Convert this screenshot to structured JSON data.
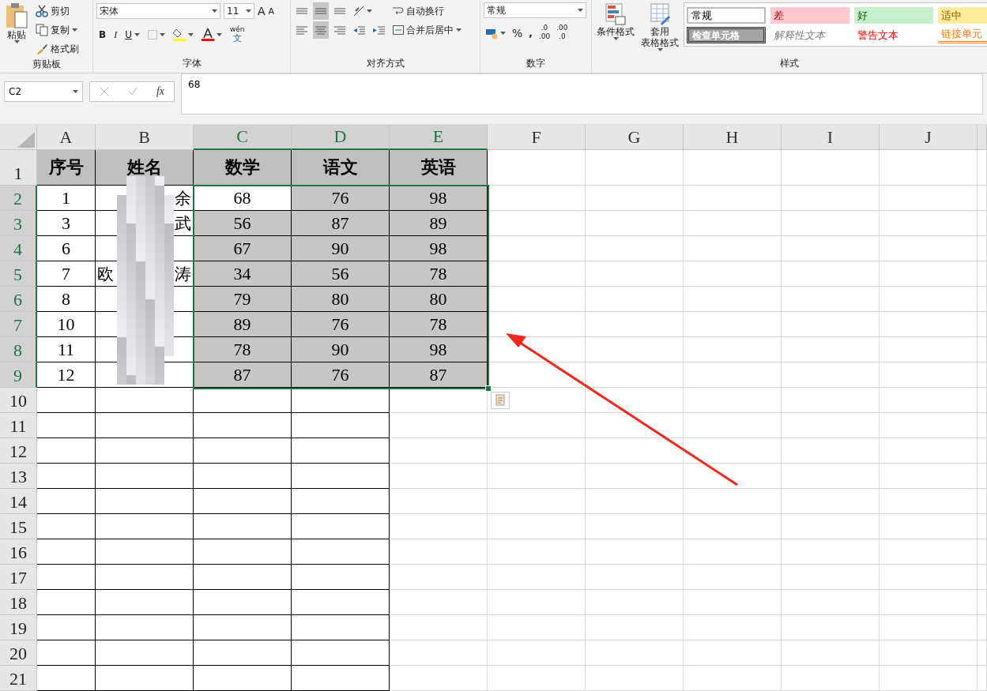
{
  "ribbon": {
    "clipboard": {
      "paste": "粘贴",
      "cut": "剪切",
      "copy": "复制",
      "format_painter": "格式刷",
      "label": "剪贴板"
    },
    "font": {
      "name": "宋体",
      "size": "11",
      "grow": "A",
      "shrink": "A",
      "bold": "B",
      "italic": "I",
      "underline": "U",
      "phonetic_top": "wén",
      "phonetic_bottom": "文",
      "label": "字体"
    },
    "alignment": {
      "top_buttons": [
        {
          "selected": false
        },
        {
          "selected": true
        },
        {
          "selected": false
        }
      ],
      "bottom_buttons": [
        {
          "selected": false
        },
        {
          "selected": true
        },
        {
          "selected": false
        }
      ],
      "wrap": "自动换行",
      "merge": "合并后居中",
      "label": "对齐方式"
    },
    "number": {
      "format": "常规",
      "percent": "%",
      "comma": ",",
      "increase_decimal": [
        ".0",
        ".00"
      ],
      "decrease_decimal": [
        ".00",
        ".0"
      ],
      "label": "数字"
    },
    "conditional": "条件格式",
    "table_format": [
      "套用",
      "表格格式"
    ],
    "styles": [
      {
        "text": "常规",
        "kind": "normal"
      },
      {
        "text": "差",
        "kind": "bad"
      },
      {
        "text": "好",
        "kind": "good"
      },
      {
        "text": "适中",
        "kind": "neutral"
      },
      {
        "text": "检查单元格",
        "kind": "check"
      },
      {
        "text": "解释性文本",
        "kind": "explanatory"
      },
      {
        "text": "警告文本",
        "kind": "warning"
      },
      {
        "text": "链接单元",
        "kind": "linked"
      }
    ],
    "styles_label": "样式"
  },
  "formula_bar": {
    "name_box": "C2",
    "function_label": "fx",
    "formula": "68"
  },
  "columns": [
    {
      "label": "A",
      "selected": false
    },
    {
      "label": "B",
      "selected": false
    },
    {
      "label": "C",
      "selected": true
    },
    {
      "label": "D",
      "selected": true
    },
    {
      "label": "E",
      "selected": true
    },
    {
      "label": "F",
      "selected": false
    },
    {
      "label": "G",
      "selected": false
    },
    {
      "label": "H",
      "selected": false
    },
    {
      "label": "I",
      "selected": false
    },
    {
      "label": "J",
      "selected": false
    }
  ],
  "table": {
    "header_row": "1",
    "headers": [
      "序号",
      "姓名",
      "数学",
      "语文",
      "英语"
    ],
    "rows": [
      {
        "number": "2",
        "selected": true,
        "seq": "1",
        "name_left": "",
        "name_right": "余",
        "scores": [
          {
            "text": "68",
            "selected": false
          },
          {
            "text": "76",
            "selected": true
          },
          {
            "text": "98",
            "selected": true
          }
        ]
      },
      {
        "number": "3",
        "selected": true,
        "seq": "3",
        "name_left": "",
        "name_right": "武",
        "scores": [
          {
            "text": "56",
            "selected": true
          },
          {
            "text": "87",
            "selected": true
          },
          {
            "text": "89",
            "selected": true
          }
        ]
      },
      {
        "number": "4",
        "selected": true,
        "seq": "6",
        "name_left": "",
        "name_right": "",
        "scores": [
          {
            "text": "67",
            "selected": true
          },
          {
            "text": "90",
            "selected": true
          },
          {
            "text": "98",
            "selected": true
          }
        ]
      },
      {
        "number": "5",
        "selected": true,
        "seq": "7",
        "name_left": "欧",
        "name_right": "涛",
        "scores": [
          {
            "text": "34",
            "selected": true
          },
          {
            "text": "56",
            "selected": true
          },
          {
            "text": "78",
            "selected": true
          }
        ]
      },
      {
        "number": "6",
        "selected": true,
        "seq": "8",
        "name_left": "",
        "name_right": "",
        "scores": [
          {
            "text": "79",
            "selected": true
          },
          {
            "text": "80",
            "selected": true
          },
          {
            "text": "80",
            "selected": true
          }
        ]
      },
      {
        "number": "7",
        "selected": true,
        "seq": "10",
        "name_left": "",
        "name_right": "",
        "scores": [
          {
            "text": "89",
            "selected": true
          },
          {
            "text": "76",
            "selected": true
          },
          {
            "text": "78",
            "selected": true
          }
        ]
      },
      {
        "number": "8",
        "selected": true,
        "seq": "11",
        "name_left": "",
        "name_right": "",
        "scores": [
          {
            "text": "78",
            "selected": true
          },
          {
            "text": "90",
            "selected": true
          },
          {
            "text": "98",
            "selected": true
          }
        ]
      },
      {
        "number": "9",
        "selected": true,
        "seq": "12",
        "name_left": "",
        "name_right": "",
        "scores": [
          {
            "text": "87",
            "selected": true
          },
          {
            "text": "76",
            "selected": true
          },
          {
            "text": "87",
            "selected": true
          }
        ]
      }
    ],
    "empty_rows": [
      "10",
      "11",
      "12",
      "13",
      "14",
      "15",
      "16",
      "17",
      "18",
      "19",
      "20",
      "21"
    ]
  }
}
